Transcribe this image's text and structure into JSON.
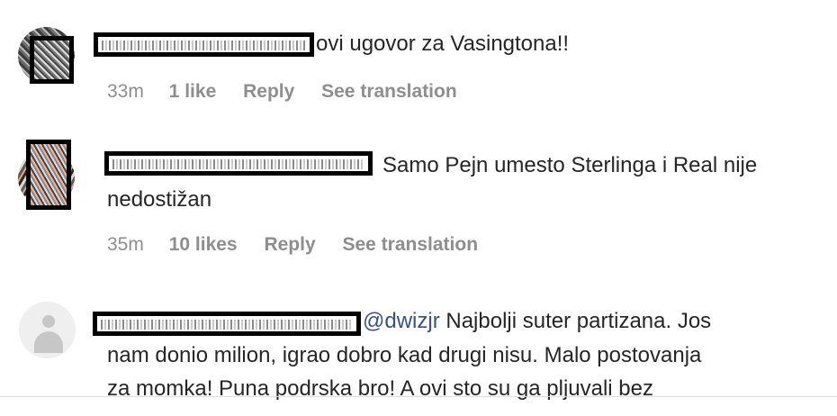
{
  "comments": [
    {
      "text": "ovi ugovor za Vasingtona!!",
      "time": "33m",
      "likes": "1 like",
      "reply": "Reply",
      "translate": "See translation"
    },
    {
      "text_line1": "Samo Pejn umesto Sterlinga i Real nije",
      "text_line2": "nedostižan",
      "time": "35m",
      "likes": "10 likes",
      "reply": "Reply",
      "translate": "See translation"
    },
    {
      "mention": "@dwizjr",
      "text_line1": " Najbolji suter partizana. Jos",
      "text_line2": "nam donio milion, igrao dobro kad drugi nisu. Malo postovanja",
      "text_line3": "za momka! Puna podrska bro! A ovi sto su ga pljuvali bez"
    }
  ]
}
